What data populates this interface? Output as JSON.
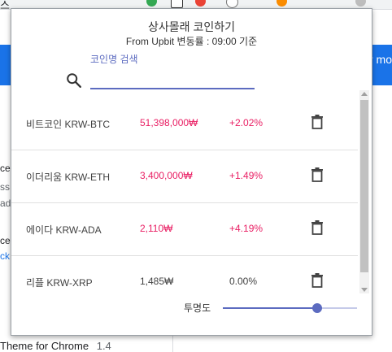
{
  "background": {
    "tab_fragment": "스",
    "left_fragments": [
      "ces",
      "ss",
      "ad",
      "cel",
      "ck"
    ],
    "blue_fragment": "er mo",
    "footer_text": "Theme for Chrome",
    "footer_version": "1.4"
  },
  "popup": {
    "title": "상사몰래 코인하기",
    "subtitle": "From Upbit 변동률 : 09:00 기준",
    "search": {
      "label": "코인명 검색",
      "value": "",
      "placeholder": ""
    },
    "coins": [
      {
        "name": "비트코인 KRW-BTC",
        "price": "51,398,000₩",
        "change": "+2.02%",
        "trend": "up"
      },
      {
        "name": "이더리움 KRW-ETH",
        "price": "3,400,000₩",
        "change": "+1.49%",
        "trend": "up"
      },
      {
        "name": "에이다 KRW-ADA",
        "price": "2,110₩",
        "change": "+4.19%",
        "trend": "up"
      },
      {
        "name": "리플 KRW-XRP",
        "price": "1,485₩",
        "change": "0.00%",
        "trend": "flat"
      }
    ],
    "opacity": {
      "label": "투명도",
      "value": 0.7
    }
  },
  "colors": {
    "accent": "#5c6bc0",
    "up": "#e91e63",
    "flat": "#424242",
    "browser_blue": "#1a73e8"
  }
}
